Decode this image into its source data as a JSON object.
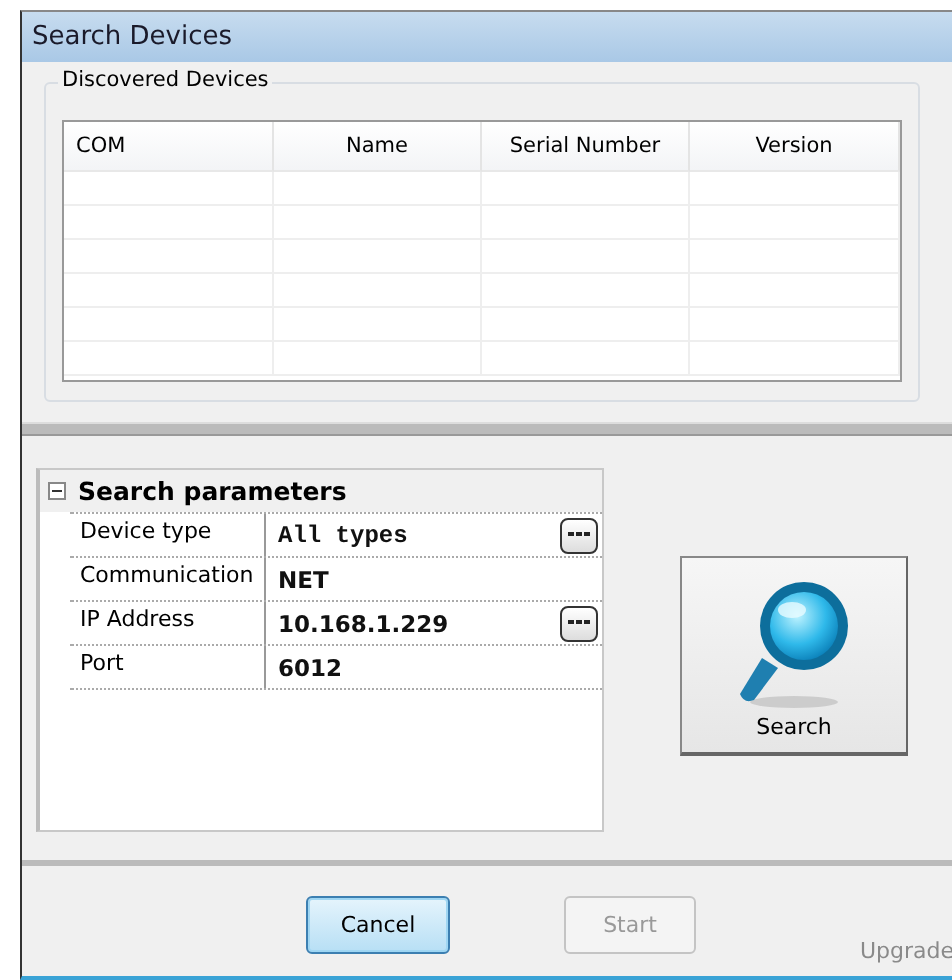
{
  "window": {
    "title": "Search Devices"
  },
  "discovered": {
    "title": "Discovered Devices",
    "columns": [
      "COM",
      "Name",
      "Serial Number",
      "Version"
    ]
  },
  "parameters": {
    "title": "Search parameters",
    "expanded": true,
    "rows": [
      {
        "label": "Device type",
        "value": "All types",
        "kind": "choice"
      },
      {
        "label": "Communication",
        "value": "NET",
        "kind": "text"
      },
      {
        "label": "IP Address",
        "value": "10.168.1.229",
        "kind": "browse"
      },
      {
        "label": "Port",
        "value": "6012",
        "kind": "text"
      }
    ]
  },
  "search_button": {
    "label": "Search"
  },
  "buttons": [
    {
      "label": "Cancel",
      "focused": true,
      "disabled": false
    },
    {
      "label": "Start",
      "focused": false,
      "disabled": true
    }
  ],
  "upgrade": {
    "label": "Upgrade",
    "disabled": true
  }
}
